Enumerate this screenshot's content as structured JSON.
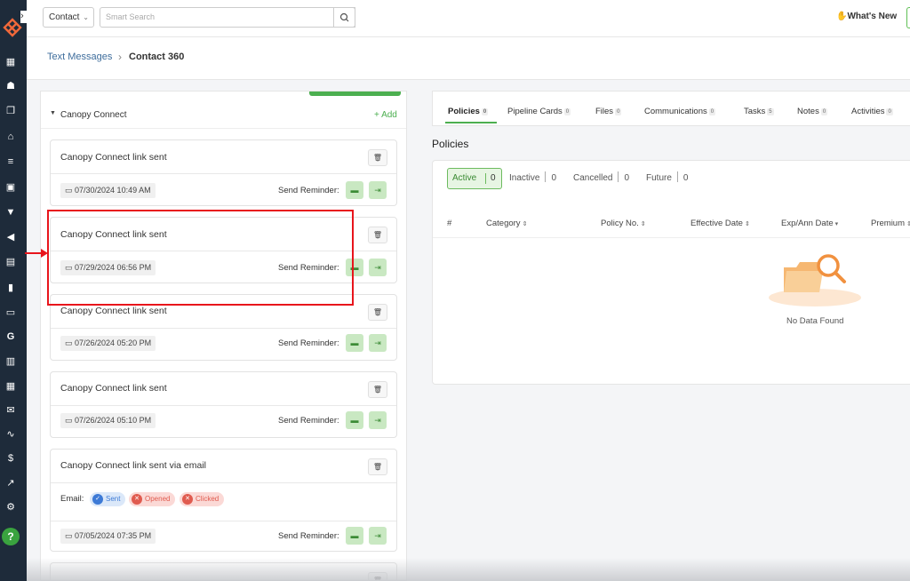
{
  "top": {
    "contact_select": "Contact",
    "search_placeholder": "Smart Search",
    "whats_new": "What's New"
  },
  "breadcrumb": {
    "parent": "Text Messages",
    "separator": "›",
    "current": "Contact 360"
  },
  "section": {
    "title": "Canopy Connect",
    "add": "+ Add"
  },
  "cards": [
    {
      "title": "Canopy Connect link sent",
      "date": "07/30/2024 10:49 AM",
      "reminder": "Send Reminder:"
    },
    {
      "title": "Canopy Connect link sent",
      "date": "07/29/2024 06:56 PM",
      "reminder": "Send Reminder:"
    },
    {
      "title": "Canopy Connect link sent",
      "date": "07/26/2024 05:20 PM",
      "reminder": "Send Reminder:"
    },
    {
      "title": "Canopy Connect link sent",
      "date": "07/26/2024 05:10 PM",
      "reminder": "Send Reminder:"
    },
    {
      "title": "Canopy Connect link sent via email",
      "date": "07/05/2024 07:35 PM",
      "reminder": "Send Reminder:",
      "email_label": "Email:",
      "statuses": [
        "Sent",
        "Opened",
        "Clicked"
      ]
    }
  ],
  "tabs": [
    {
      "label": "Policies",
      "count": "0"
    },
    {
      "label": "Pipeline Cards",
      "count": "0"
    },
    {
      "label": "Files",
      "count": "0"
    },
    {
      "label": "Communications",
      "count": "0"
    },
    {
      "label": "Tasks",
      "count": "5"
    },
    {
      "label": "Notes",
      "count": "0"
    },
    {
      "label": "Activities",
      "count": "0"
    }
  ],
  "policies": {
    "title": "Policies",
    "filters": [
      {
        "label": "Active",
        "count": "0"
      },
      {
        "label": "Inactive",
        "count": "0"
      },
      {
        "label": "Cancelled",
        "count": "0"
      },
      {
        "label": "Future",
        "count": "0"
      }
    ],
    "columns": [
      "#",
      "Category",
      "Policy No.",
      "Effective Date",
      "Exp/Ann Date",
      "Premium"
    ],
    "empty_text": "No Data Found"
  },
  "colors": {
    "sidebar": "#1e2b3a",
    "accent_green": "#4caf50",
    "highlight_red": "#e8151c",
    "link_blue": "#3e6d9c"
  },
  "icons": [
    "logo-icon",
    "dashboard-icon",
    "contacts-icon",
    "copy-icon",
    "bank-icon",
    "list-icon",
    "id-card-icon",
    "filter-icon",
    "megaphone-icon",
    "document-icon",
    "bar-chart-icon",
    "folder-icon",
    "google-icon",
    "file-icon",
    "calendar-icon",
    "mail-icon",
    "signature-icon",
    "dollar-icon",
    "line-chart-icon",
    "gear-icon",
    "help-icon"
  ]
}
